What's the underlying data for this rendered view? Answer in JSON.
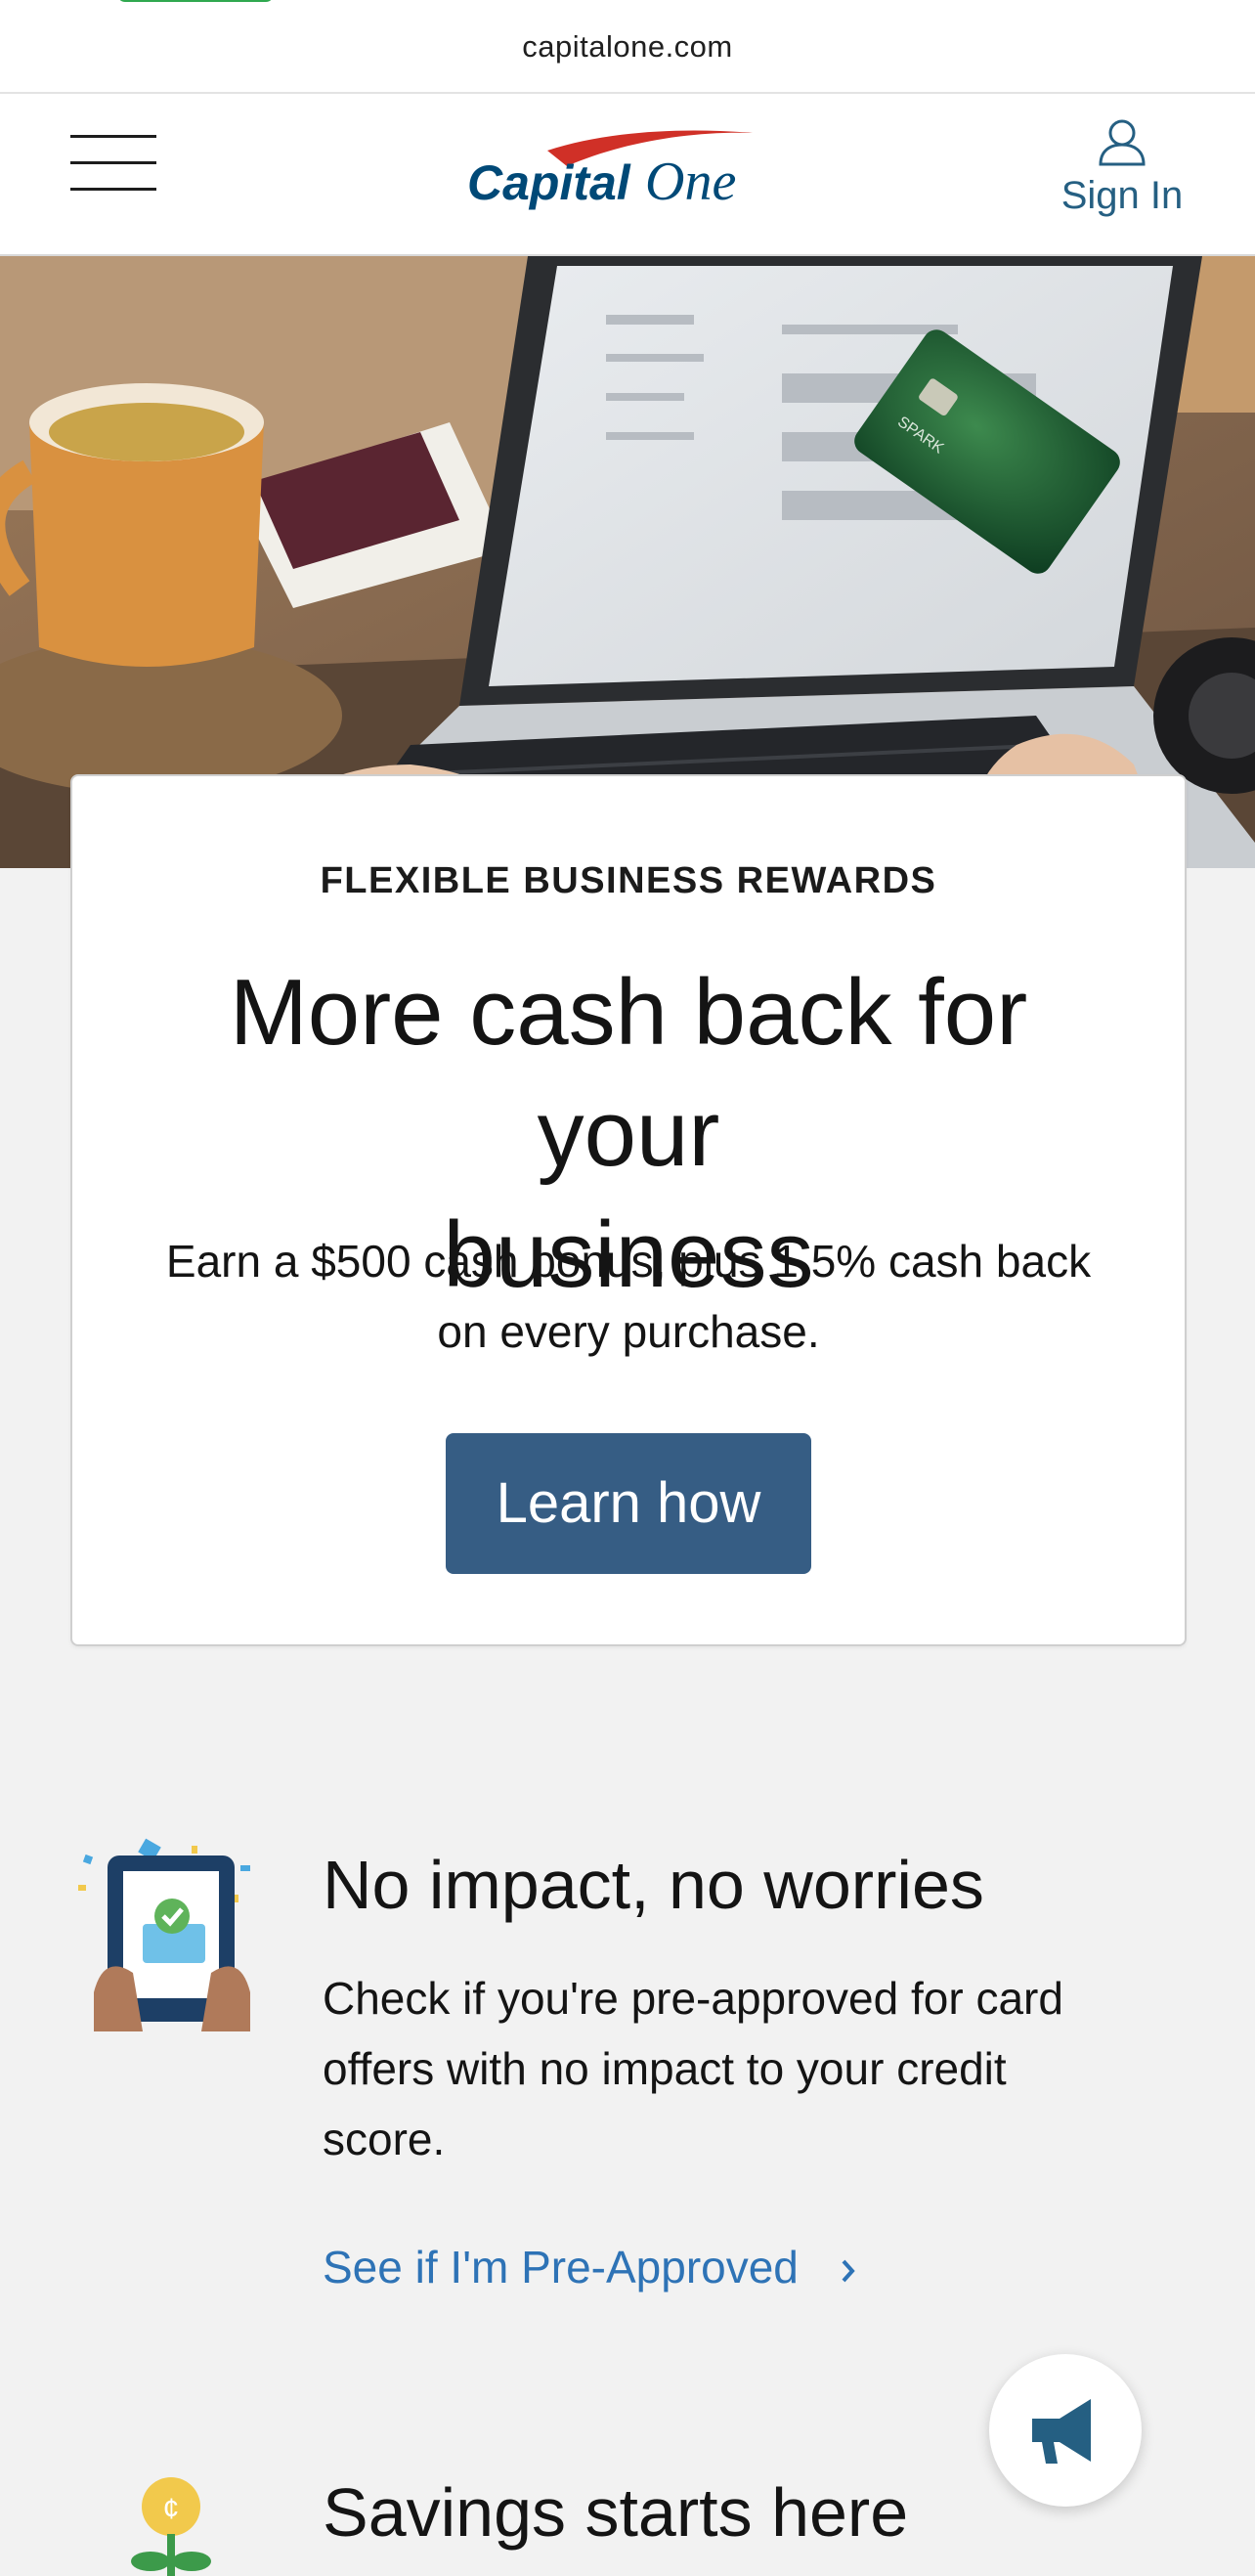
{
  "browser": {
    "url": "capitalone.com"
  },
  "header": {
    "menu_icon": "hamburger-menu-icon",
    "logo_text": "CapitalOne",
    "signin_label": "Sign In",
    "signin_icon": "user-icon"
  },
  "hero": {
    "image": "laptop-with-spark-business-card-photo",
    "card_lettering": "SPARK"
  },
  "promo": {
    "eyebrow": "FLEXIBLE BUSINESS REWARDS",
    "headline_line1": "More cash back for your",
    "headline_line2": "business",
    "subtext_line1": "Earn a $500 cash bonus, plus 1.5% cash back",
    "subtext_line2": "on every purchase.",
    "cta_label": "Learn how",
    "cta_color": "#365d84"
  },
  "features": [
    {
      "icon": "tablet-approved-icon",
      "title": "No impact, no worries",
      "body_line1": "Check if you're pre-approved for card",
      "body_line2": "offers with no impact to your credit",
      "body_line3": "score.",
      "link_label": "See if I'm Pre-Approved"
    },
    {
      "icon": "savings-plant-icon",
      "title": "Savings starts here"
    }
  ],
  "feedback_button": {
    "icon": "megaphone-icon"
  },
  "colors": {
    "link": "#2e73b6",
    "brand_red": "#d03027",
    "brand_navy": "#004977"
  }
}
